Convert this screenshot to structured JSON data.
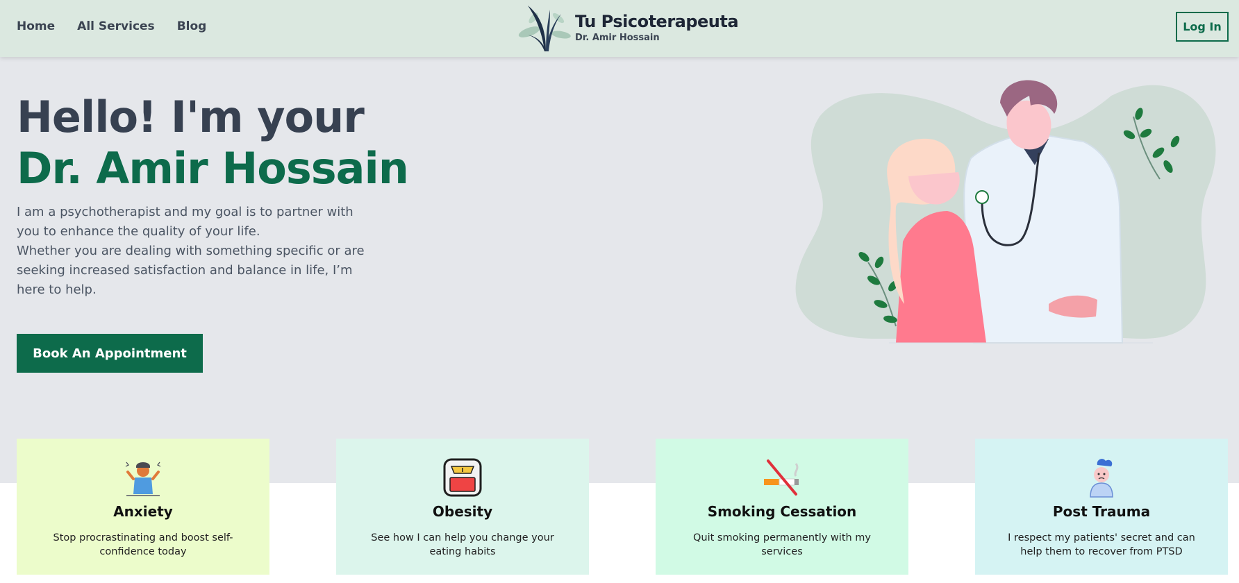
{
  "nav": {
    "links": [
      "Home",
      "All Services",
      "Blog"
    ],
    "brand_title": "Tu Psicoterapeuta",
    "brand_subtitle": "Dr. Amir Hossain",
    "login_label": "Log In"
  },
  "hero": {
    "title_line1": "Hello! I'm your",
    "title_line2": "Dr. Amir Hossain",
    "paragraph1": "I am a psychotherapist and my goal is to partner with you to enhance the quality of your life.",
    "paragraph2": "Whether you are dealing with something specific or are seeking increased satisfaction and balance in life, I’m here to help.",
    "cta_label": "Book An Appointment",
    "illustration": "doctor-patient-illustration"
  },
  "services": [
    {
      "title": "Anxiety",
      "description": "Stop procrastinating and boost self-confidence today",
      "icon": "anxious-person-icon",
      "bg": "#ecfccb"
    },
    {
      "title": "Obesity",
      "description": "See how I can help you change your eating habits",
      "icon": "weighing-scale-icon",
      "bg": "#dcf5ec"
    },
    {
      "title": "Smoking Cessation",
      "description": "Quit smoking permanently with my services",
      "icon": "no-smoking-icon",
      "bg": "#d1fae5"
    },
    {
      "title": "Post Trauma",
      "description": "I respect my patients' secret and can help them to recover from PTSD",
      "icon": "sad-person-cloud-icon",
      "bg": "#d5f3f3"
    }
  ],
  "colors": {
    "brand_green": "#0d6b4b",
    "nav_bg": "#dbe8e0",
    "hero_bg": "#e5e7eb",
    "heading_dark": "#374151"
  }
}
